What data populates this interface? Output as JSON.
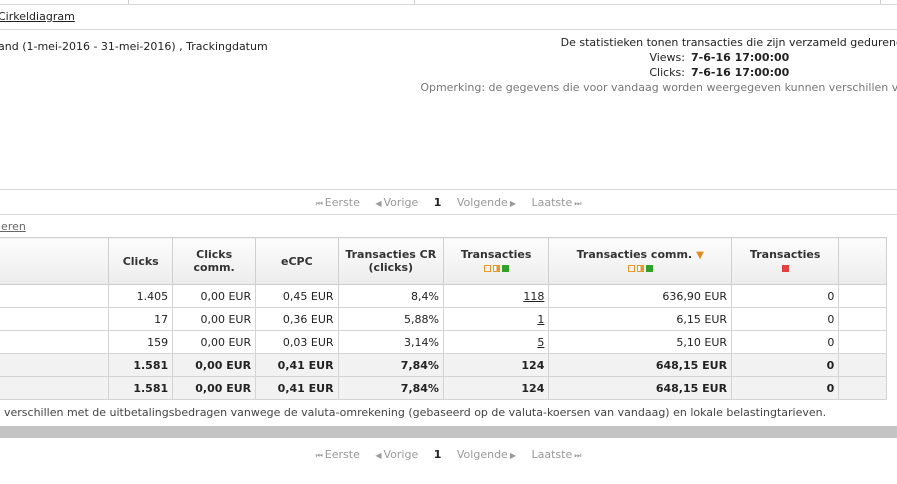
{
  "header": {
    "pie_chart_link": "Cirkeldiagram"
  },
  "period_text": "and (1-mei-2016 - 31-mei-2016) , Trackingdatum",
  "stats": {
    "line1": "De statistieken tonen transacties die zijn verzameld gedurend",
    "views_label": "Views:",
    "views_value": "7-6-16 17:00:00",
    "clicks_label": "Clicks:",
    "clicks_value": "7-6-16 17:00:00",
    "note": "Opmerking: de gegevens die voor vandaag worden weergegeven kunnen verschillen va"
  },
  "pager": {
    "first": "Eerste",
    "prev": "Vorige",
    "current": "1",
    "next": "Volgende",
    "last": "Laatste"
  },
  "filter_link": "leren",
  "table": {
    "headers": {
      "clicks": "Clicks",
      "clicks_comm": "Clicks comm.",
      "ecpc": "eCPC",
      "cr": "Transacties CR (clicks)",
      "trans": "Transacties",
      "trans_comm": "Transacties comm.",
      "trans_rej": "Transacties"
    },
    "rows": [
      {
        "clicks": "1.405",
        "clicks_comm": "0,00 EUR",
        "ecpc": "0,45 EUR",
        "cr": "8,4%",
        "trans": "118",
        "trans_comm": "636,90 EUR",
        "trans_rej": "0"
      },
      {
        "clicks": "17",
        "clicks_comm": "0,00 EUR",
        "ecpc": "0,36 EUR",
        "cr": "5,88%",
        "trans": "1",
        "trans_comm": "6,15 EUR",
        "trans_rej": "0"
      },
      {
        "clicks": "159",
        "clicks_comm": "0,00 EUR",
        "ecpc": "0,03 EUR",
        "cr": "3,14%",
        "trans": "5",
        "trans_comm": "5,10 EUR",
        "trans_rej": "0"
      }
    ],
    "totals": [
      {
        "clicks": "1.581",
        "clicks_comm": "0,00 EUR",
        "ecpc": "0,41 EUR",
        "cr": "7,84%",
        "trans": "124",
        "trans_comm": "648,15 EUR",
        "trans_rej": "0"
      },
      {
        "clicks": "1.581",
        "clicks_comm": "0,00 EUR",
        "ecpc": "0,41 EUR",
        "cr": "7,84%",
        "trans": "124",
        "trans_comm": "648,15 EUR",
        "trans_rej": "0"
      }
    ]
  },
  "footnote": "verschillen met de uitbetalingsbedragen vanwege de valuta-omrekening (gebaseerd op de valuta-koersen van vandaag) en lokale belastingtarieven.",
  "colors": {
    "accent_orange": "#e59a2a",
    "approved_green": "#33a02c",
    "rejected_red": "#e04040"
  }
}
